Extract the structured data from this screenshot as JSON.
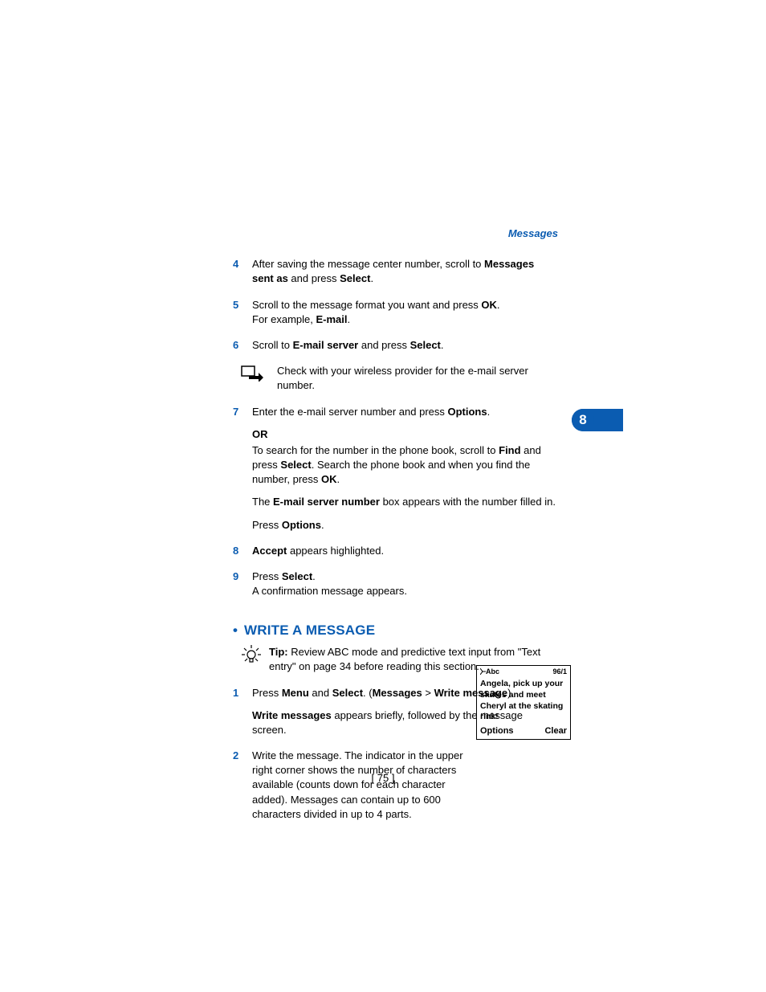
{
  "header": {
    "section_label": "Messages"
  },
  "side_tab": {
    "number": "8"
  },
  "steps_top": [
    {
      "num": "4",
      "parts": [
        {
          "t": "After saving the message center number, scroll to "
        },
        {
          "t": "Messages sent as",
          "b": true
        },
        {
          "t": " and press "
        },
        {
          "t": "Select",
          "b": true
        },
        {
          "t": "."
        }
      ]
    },
    {
      "num": "5",
      "parts": [
        {
          "t": "Scroll to the message format you want and press "
        },
        {
          "t": "OK",
          "b": true
        },
        {
          "t": "."
        }
      ],
      "extra_line": [
        {
          "t": "For example, "
        },
        {
          "t": "E-mail",
          "b": true
        },
        {
          "t": "."
        }
      ]
    },
    {
      "num": "6",
      "parts": [
        {
          "t": "Scroll to "
        },
        {
          "t": "E-mail server",
          "b": true
        },
        {
          "t": " and press "
        },
        {
          "t": "Select",
          "b": true
        },
        {
          "t": "."
        }
      ]
    }
  ],
  "provider_note": "Check with your wireless provider for the e-mail server number.",
  "step7": {
    "num": "7",
    "line1": [
      {
        "t": "Enter the e-mail server number and press "
      },
      {
        "t": "Options",
        "b": true
      },
      {
        "t": "."
      }
    ],
    "or_label": "OR",
    "line2": [
      {
        "t": "To search for the number in the phone book, scroll to "
      },
      {
        "t": "Find",
        "b": true
      },
      {
        "t": " and press "
      },
      {
        "t": "Select",
        "b": true
      },
      {
        "t": ". Search the phone book and when you find the number, press "
      },
      {
        "t": "OK",
        "b": true
      },
      {
        "t": "."
      }
    ],
    "line3": [
      {
        "t": "The "
      },
      {
        "t": "E-mail server number",
        "b": true
      },
      {
        "t": " box appears with the number filled in."
      }
    ],
    "line4": [
      {
        "t": "Press "
      },
      {
        "t": "Options",
        "b": true
      },
      {
        "t": "."
      }
    ]
  },
  "step8": {
    "num": "8",
    "parts": [
      {
        "t": "Accept",
        "b": true
      },
      {
        "t": " appears highlighted."
      }
    ]
  },
  "step9": {
    "num": "9",
    "line1": [
      {
        "t": "Press "
      },
      {
        "t": "Select",
        "b": true
      },
      {
        "t": "."
      }
    ],
    "line2": "A confirmation message appears."
  },
  "section2": {
    "bullet": "•",
    "heading": "WRITE A MESSAGE"
  },
  "tip": {
    "label": "Tip:",
    "text": " Review ABC mode and predictive text input from \"Text entry\" on page 34 before reading this section."
  },
  "write_step1": {
    "num": "1",
    "line1": [
      {
        "t": "Press "
      },
      {
        "t": "Menu",
        "b": true
      },
      {
        "t": " and "
      },
      {
        "t": "Select",
        "b": true
      },
      {
        "t": ". ("
      },
      {
        "t": "Messages",
        "b": true
      },
      {
        "t": " > "
      },
      {
        "t": "Write message",
        "b": true
      },
      {
        "t": ")."
      }
    ],
    "line2": [
      {
        "t": "Write messages",
        "b": true
      },
      {
        "t": " appears briefly, followed by the message screen."
      }
    ]
  },
  "write_step2": {
    "num": "2",
    "text": "Write the message. The indicator in the upper right corner shows the number of characters available (counts down for each character added). Messages can contain up to 600 characters divided in up to 4 parts."
  },
  "phone": {
    "mode": "Abc",
    "counter": "96/1",
    "message": "Angela, pick up your skates and meet Cheryl at the skating rink!",
    "left_softkey": "Options",
    "right_softkey": "Clear"
  },
  "page_number": "[ 75 ]"
}
